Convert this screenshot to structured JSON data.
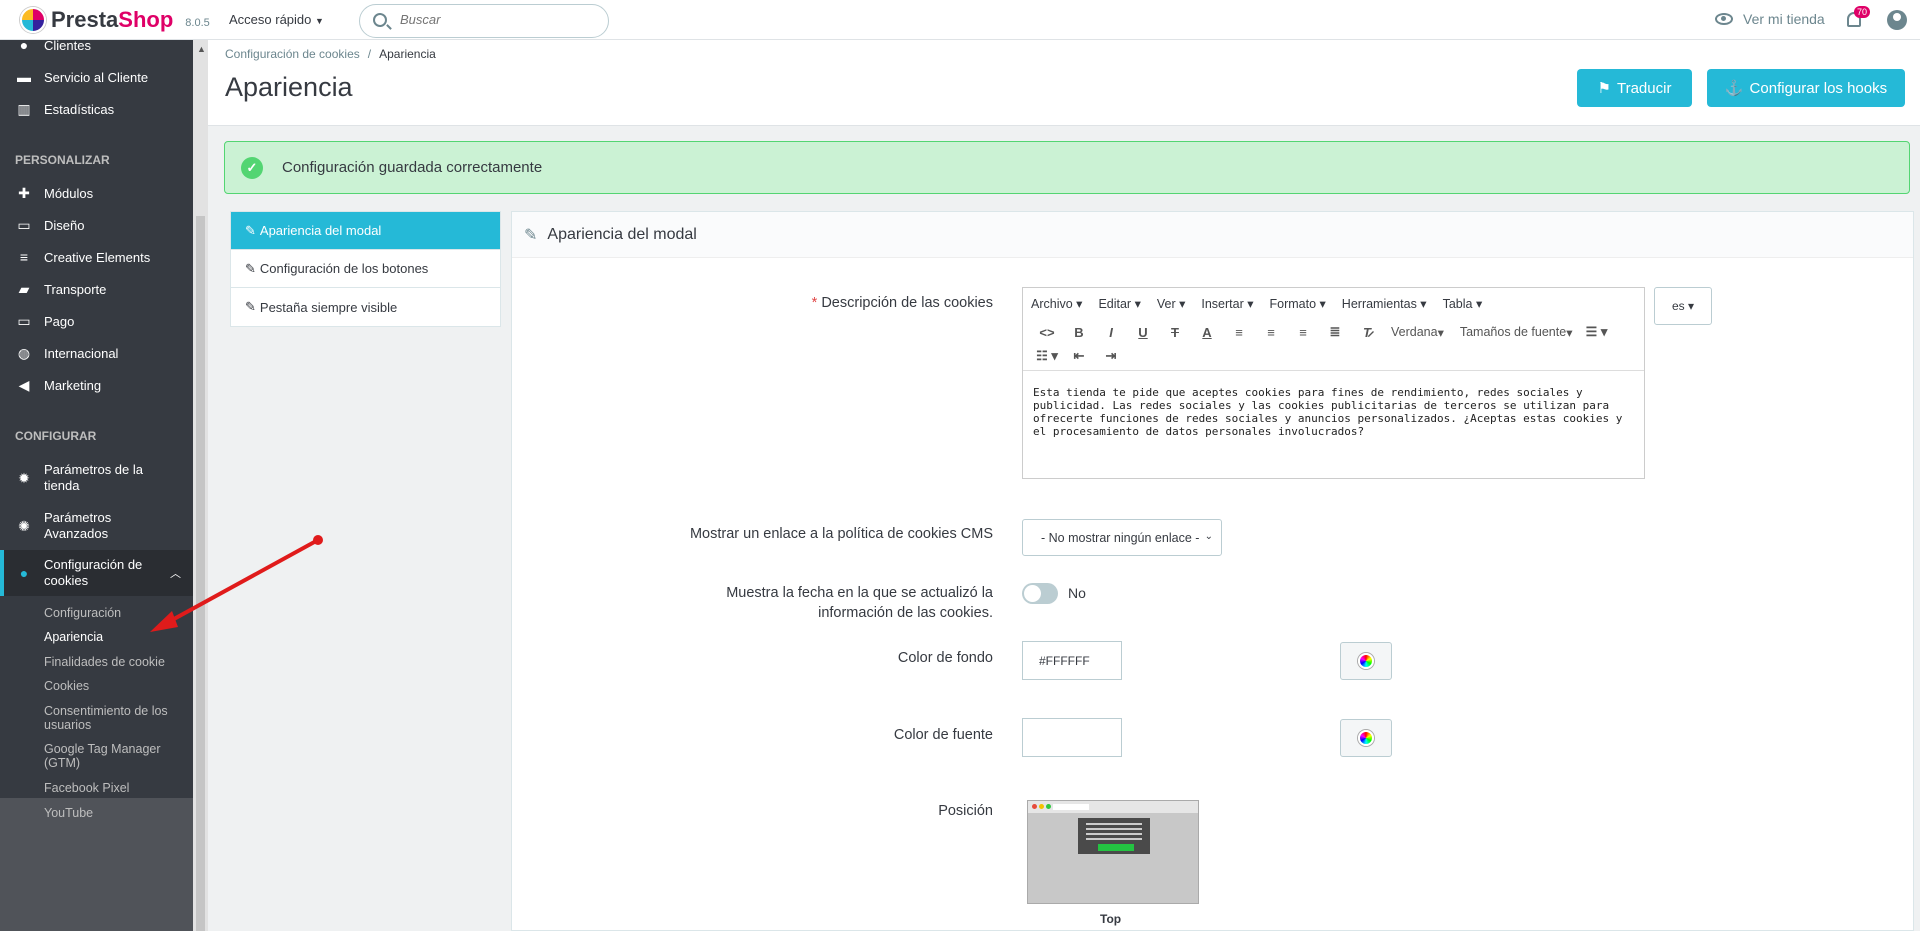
{
  "topbar": {
    "brand_prefix": "Presta",
    "brand_suffix": "Shop",
    "version": "8.0.5",
    "quick_access": "Acceso rápido",
    "search_placeholder": "Buscar",
    "view_store": "Ver mi tienda",
    "notifications_count": "70"
  },
  "sidebar": {
    "items_top": [
      {
        "label": "Clientes",
        "icon": "user-icon"
      },
      {
        "label": "Servicio al Cliente",
        "icon": "chat-icon"
      },
      {
        "label": "Estadísticas",
        "icon": "chart-icon"
      }
    ],
    "section_personalizar": "PERSONALIZAR",
    "items_personalizar": [
      {
        "label": "Módulos",
        "icon": "puzzle-icon"
      },
      {
        "label": "Diseño",
        "icon": "monitor-icon"
      },
      {
        "label": "Creative Elements",
        "icon": "elements-icon"
      },
      {
        "label": "Transporte",
        "icon": "truck-icon"
      },
      {
        "label": "Pago",
        "icon": "card-icon"
      },
      {
        "label": "Internacional",
        "icon": "globe-icon"
      },
      {
        "label": "Marketing",
        "icon": "megaphone-icon"
      }
    ],
    "section_configurar": "CONFIGURAR",
    "items_configurar": [
      {
        "label1": "Parámetros de la",
        "label2": "tienda",
        "icon": "gear-icon"
      },
      {
        "label1": "Parámetros",
        "label2": "Avanzados",
        "icon": "gear-box-icon"
      },
      {
        "label1": "Configuración de",
        "label2": "cookies",
        "icon": "cookie-icon"
      }
    ],
    "subitems": [
      {
        "label": "Configuración"
      },
      {
        "label": "Apariencia"
      },
      {
        "label": "Finalidades de cookie"
      },
      {
        "label": "Cookies"
      },
      {
        "label1": "Consentimiento de los",
        "label2": "usuarios"
      },
      {
        "label1": "Google Tag Manager",
        "label2": "(GTM)"
      },
      {
        "label": "Facebook Pixel"
      },
      {
        "label": "YouTube"
      }
    ]
  },
  "header": {
    "breadcrumb": [
      "Configuración de cookies",
      "Apariencia"
    ],
    "title": "Apariencia",
    "translate_button": "Traducir",
    "hooks_button": "Configurar los hooks"
  },
  "alert": {
    "message": "Configuración guardada correctamente"
  },
  "tabs": [
    "Apariencia del modal",
    "Configuración de los botones",
    "Pestaña siempre visible"
  ],
  "panel": {
    "title": "Apariencia del modal",
    "desc_label": "Descripción de las cookies",
    "editor_menu": [
      "Archivo",
      "Editar",
      "Ver",
      "Insertar",
      "Formato",
      "Herramientas",
      "Tabla"
    ],
    "editor_font": "Verdana",
    "editor_size": "Tamaños de fuente",
    "editor_text": "Esta tienda te pide que aceptes cookies para fines de rendimiento, redes sociales y publicidad. Las redes sociales y las cookies publicitarias de terceros se utilizan para ofrecerte funciones de redes sociales y anuncios personalizados. ¿Aceptas estas cookies y el procesamiento de datos personales involucrados?",
    "lang": "es",
    "cms_label": "Mostrar un enlace a la política de cookies CMS",
    "cms_value": "- No mostrar ningún enlace -",
    "date_label1": "Muestra la fecha en la que se actualizó la",
    "date_label2": "información de las cookies.",
    "date_value": "No",
    "bg_label": "Color de fondo",
    "bg_value": "#FFFFFF",
    "font_label": "Color de fuente",
    "font_value": "",
    "position_label": "Posición",
    "position_value": "Top"
  }
}
